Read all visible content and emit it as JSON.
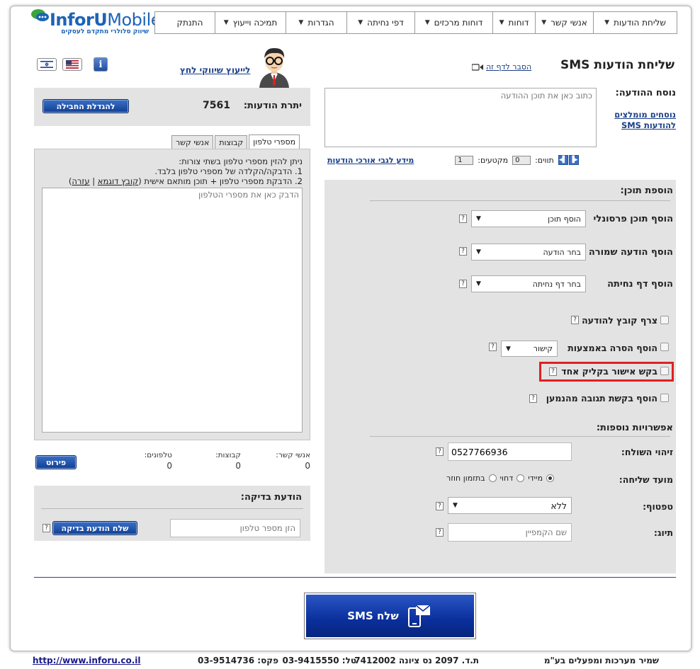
{
  "logo": {
    "brand_a": "InforU",
    "brand_b": "Mobile",
    "tagline": "שיווק סלולרי מתקדם לעסקים"
  },
  "menu": [
    {
      "label": "שליחת הודעות",
      "caret": true
    },
    {
      "label": "אנשי קשר",
      "caret": true
    },
    {
      "label": "דוחות",
      "caret": true
    },
    {
      "label": "דוחות מרכזים",
      "caret": true
    },
    {
      "label": "דפי נחיתה",
      "caret": true
    },
    {
      "label": "הגדרות",
      "caret": true
    },
    {
      "label": "תמיכה וייעוץ",
      "caret": true
    },
    {
      "label": "התנתק",
      "caret": false
    }
  ],
  "page": {
    "title": "שליחת הודעות SMS",
    "explain_link": "הסבר לדף זה"
  },
  "consultant_link": "לייעוץ שיווקי לחץ",
  "message": {
    "label": "נוסח ההודעה:",
    "placeholder": "כתוב כאן את תוכן ההודעה",
    "recommended_link": "נוסחים מומלצים להודעות SMS",
    "chars_label": "תווים:",
    "chars_value": "0",
    "segments_label": "מקטעים:",
    "segments_value": "1",
    "long_link": "מידע לגבי אורכי הודעות"
  },
  "balance": {
    "label": "יתרת הודעות:",
    "value": "7561",
    "upgrade_button": "להגדלת החבילה"
  },
  "tabs": [
    "אנשי קשר",
    "קבוצות",
    "מספרי טלפון"
  ],
  "phones": {
    "intro": "ניתן להזין מספרי טלפון בשתי צורות:",
    "line1": "1. הדבקה/הקלדה של מספרי טלפון בלבד.",
    "line2": "2. הדבקת מספרי טלפון + תוכן מותאם אישית",
    "sample_link": "קובץ דוגמא",
    "help_link": "עזרה",
    "placeholder": "הדבק כאן את מספרי הטלפון"
  },
  "counts": {
    "contacts_label": "אנשי קשר:",
    "contacts_value": "0",
    "groups_label": "קבוצות:",
    "groups_value": "0",
    "phones_label": "טלפונים:",
    "phones_value": "0",
    "details_button": "פירוט"
  },
  "test_message": {
    "title": "הודעת בדיקה:",
    "phone_placeholder": "הזן מספר טלפון",
    "send_button": "שלח הודעת בדיקה"
  },
  "add_content": {
    "title": "הוספת תוכן:",
    "personal_label": "הוסף תוכן פרסונלי",
    "personal_select": "הוסף תוכן",
    "saved_label": "הוסף הודעה שמורה",
    "saved_select": "בחר הודעה",
    "landing_label": "הוסף דף נחיתה",
    "landing_select": "בחר דף נחיתה",
    "attach_label": "צרף קובץ להודעה",
    "removal_label": "הוסף הסרה באמצעות",
    "removal_select": "קישור",
    "one_click_label": "בקש אישור בקליק אחד",
    "reply_label": "הוסף בקשת תגובה מהנמען",
    "help_char": "?"
  },
  "more_options": {
    "title": "אפשרויות נוספות:",
    "sender_label": "זיהוי השולח:",
    "sender_value": "0527766936",
    "timing_label": "מועד שליחה:",
    "timing_options": [
      "מיידי",
      "דחוי",
      "בתזמון חוזר"
    ],
    "timing_selected": "מיידי",
    "fallback_label": "טפטוף:",
    "fallback_select": "ללא",
    "tag_label": "תיוג:",
    "tag_placeholder": "שם הקמפיין"
  },
  "send_button": "שלח SMS",
  "footer": {
    "company": "שמיר מערכות ומפעלים בע\"מ",
    "address": "ת.ד. 2097 נס ציונה 7412002",
    "phone": "טל: 03-9415550",
    "fax": "פקס: 03-9514736",
    "url": "http://www.inforu.co.il"
  },
  "colors": {
    "highlight": "#e02020",
    "brand_blue": "#1d63b6",
    "button_blue": "#0f3f93"
  }
}
